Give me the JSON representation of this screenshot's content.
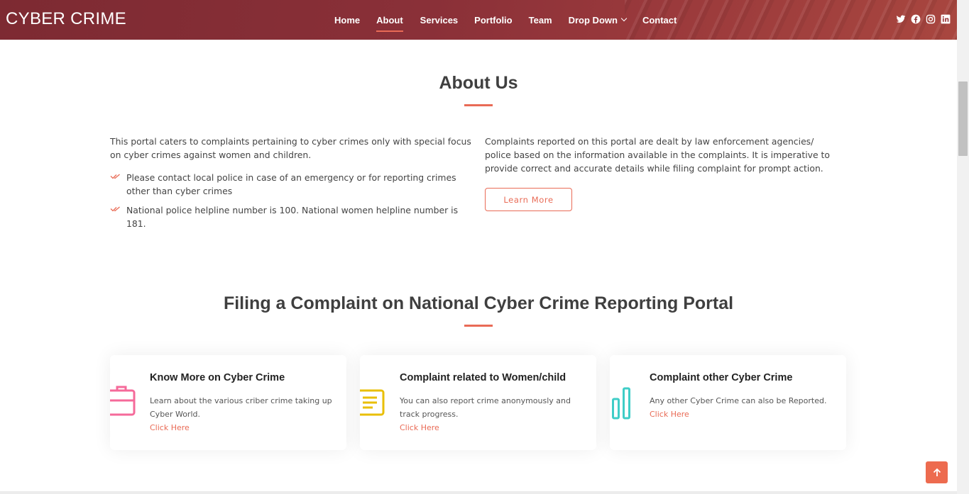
{
  "brand": {
    "logo": "CYBER CRIME"
  },
  "nav": {
    "items": [
      {
        "label": "Home"
      },
      {
        "label": "About"
      },
      {
        "label": "Services"
      },
      {
        "label": "Portfolio"
      },
      {
        "label": "Team"
      },
      {
        "label": "Drop Down"
      },
      {
        "label": "Contact"
      }
    ],
    "active": "About"
  },
  "social": [
    "twitter-icon",
    "facebook-icon",
    "instagram-icon",
    "linkedin-icon"
  ],
  "about": {
    "title": "About Us",
    "left_text": "This portal caters to complaints pertaining to cyber crimes only with special focus on cyber crimes against women and children.",
    "bullets": [
      "Please contact local police in case of an emergency or for reporting crimes other than cyber crimes",
      "National police helpline number is 100. National women helpline number is 181."
    ],
    "right_text": "Complaints reported on this portal are dealt by law enforcement agencies/ police based on the information available in the complaints. It is imperative to provide correct and accurate details while filing complaint for prompt action.",
    "button": "Learn More"
  },
  "filing": {
    "title": "Filing a Complaint on National Cyber Crime Reporting Portal",
    "cards": [
      {
        "title": "Know More on Cyber Crime",
        "text": "Learn about the various criber crime taking up Cyber World.",
        "link": "Click Here",
        "icon": "briefcase-icon"
      },
      {
        "title": "Complaint related to Women/child",
        "text": "You can also report crime anonymously and track progress.",
        "link": "Click Here",
        "icon": "list-icon"
      },
      {
        "title": "Complaint other Cyber Crime",
        "text": "Any other Cyber Crime can also be Reported.",
        "link": "Click Here",
        "icon": "bar-chart-icon"
      }
    ]
  },
  "colors": {
    "accent": "#e96b56",
    "header": "#8a3038",
    "pink": "#f56a9a",
    "yellow": "#e9bf06",
    "teal": "#3fcdc7"
  }
}
